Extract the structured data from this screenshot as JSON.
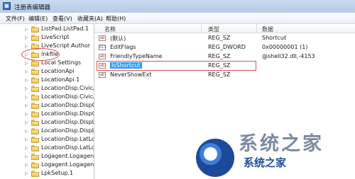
{
  "window": {
    "title": "注册表编辑器"
  },
  "menu": [
    "文件(F)",
    "编辑(E)",
    "查看(V)",
    "收藏夹(A)",
    "帮助(H)"
  ],
  "tree": {
    "items": [
      {
        "label": "ListPad.ListPad.1",
        "expander": "▷"
      },
      {
        "label": "LiveScript",
        "expander": "▷"
      },
      {
        "label": "LiveScript Author",
        "expander": "▷"
      },
      {
        "label": "lnkfile",
        "expander": "▷",
        "highlighted": true
      },
      {
        "label": "Local Settings",
        "expander": "▷"
      },
      {
        "label": "LocationApi",
        "expander": "▷"
      },
      {
        "label": "LocationApi.1",
        "expander": "▷"
      },
      {
        "label": "LocationDisp.CivicAc",
        "expander": "▷"
      },
      {
        "label": "LocationDisp.CivicAc",
        "expander": "▷"
      },
      {
        "label": "LocationDisp.DispCi",
        "expander": "▷"
      },
      {
        "label": "LocationDisp.DispCi",
        "expander": "▷"
      },
      {
        "label": "LocationDisp.DispLa",
        "expander": "▷"
      },
      {
        "label": "LocationDisp.DispLa",
        "expander": "▷"
      },
      {
        "label": "LocationDisp.LatLon",
        "expander": "▷"
      },
      {
        "label": "LocationDisp.LatLon",
        "expander": "▷"
      },
      {
        "label": "Logagent.Logagent",
        "expander": "▷"
      },
      {
        "label": "Logagent.Logagent",
        "expander": "▷"
      },
      {
        "label": "LpkSetup.1",
        "expander": "▷"
      }
    ]
  },
  "list": {
    "headers": {
      "name": "名称",
      "type": "类型",
      "data": "数据"
    },
    "rows": [
      {
        "name": "(默认)",
        "type": "REG_SZ",
        "data": "Shortcut",
        "icon": "ab"
      },
      {
        "name": "EditFlags",
        "type": "REG_DWORD",
        "data": "0x00000001 (1)",
        "icon": "011"
      },
      {
        "name": "FriendlyTypeName",
        "type": "REG_SZ",
        "data": "@shell32.dll,-4153",
        "icon": "ab"
      },
      {
        "name": "IsShortcut",
        "type": "REG_SZ",
        "data": "",
        "icon": "ab",
        "selected": true
      },
      {
        "name": "NeverShowExt",
        "type": "REG_SZ",
        "data": "",
        "icon": "ab"
      }
    ]
  },
  "watermark": {
    "top": "系统之家",
    "text": "系统之家"
  },
  "colors": {
    "selection": "#3399ff",
    "annotation": "#d9534f",
    "folder": "#efc556"
  }
}
